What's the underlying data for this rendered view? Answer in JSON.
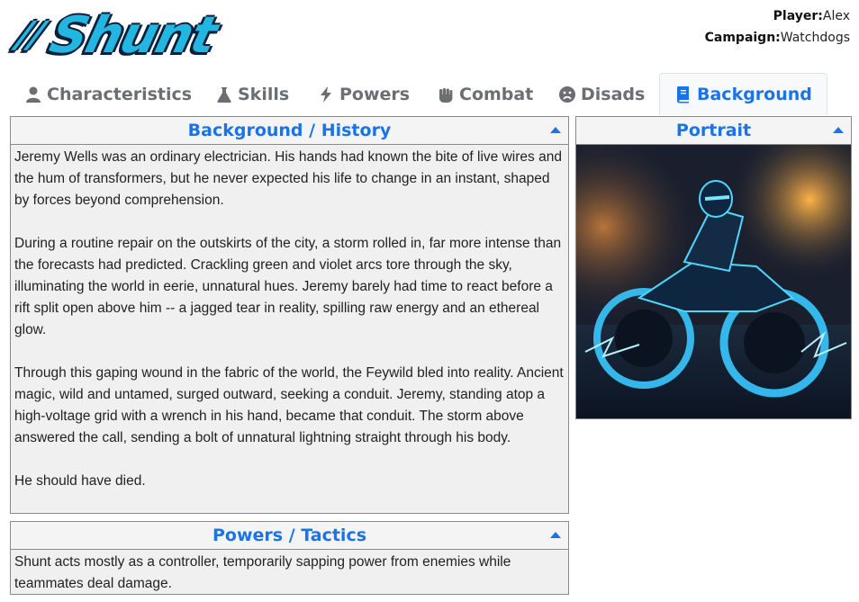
{
  "logo": {
    "text": "Shunt",
    "prefix": "//",
    "color": "#22b6e0"
  },
  "meta": {
    "player_label": "Player:",
    "player_value": "Alex",
    "campaign_label": "Campaign:",
    "campaign_value": "Watchdogs"
  },
  "tabs": [
    {
      "label": "Characteristics",
      "icon": "person-icon",
      "active": false
    },
    {
      "label": "Skills",
      "icon": "flask-icon",
      "active": false
    },
    {
      "label": "Powers",
      "icon": "bolt-icon",
      "active": false
    },
    {
      "label": "Combat",
      "icon": "fist-icon",
      "active": false
    },
    {
      "label": "Disads",
      "icon": "sad-face-icon",
      "active": false
    },
    {
      "label": "Background",
      "icon": "book-icon",
      "active": true
    }
  ],
  "background": {
    "title": "Background / History",
    "paragraphs": [
      "Jeremy Wells was an ordinary electrician. His hands had known the bite of live wires and the hum of transformers, but he never expected his life to change in an instant, shaped by forces beyond comprehension.",
      "During a routine repair on the outskirts of the city, a storm rolled in, far more intense than the forecasts had predicted. Crackling green and violet arcs tore through the sky, illuminating the world in eerie, unnatural hues. Jeremy barely had time to react before a rift split open above him -- a jagged tear in reality, spilling raw energy and an ethereal glow.",
      "Through this gaping wound in the fabric of the world, the Feywild bled into reality. Ancient magic, wild and untamed, surged outward, seeking a conduit. Jeremy, standing atop a high-voltage grid with a wrench in his hand, became that conduit. The storm above answered the call, sending a bolt of unnatural lightning straight through his body.",
      "He should have died."
    ]
  },
  "tactics": {
    "title": "Powers / Tactics",
    "paragraphs": [
      "Shunt acts mostly as a controller, temporarily sapping power from enemies while teammates deal damage."
    ]
  },
  "portrait": {
    "title": "Portrait"
  },
  "colors": {
    "accent": "#1a73e8",
    "tab_inactive": "#6b6f74",
    "panel_bg": "#f0f0f0",
    "panel_border": "#8a8a8a"
  }
}
